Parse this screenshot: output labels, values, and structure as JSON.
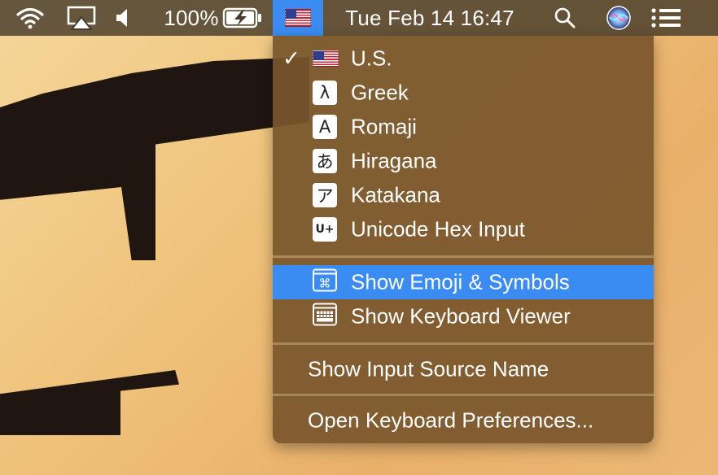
{
  "menubar": {
    "battery_percent": "100%",
    "datetime": "Tue Feb 14  16:47"
  },
  "input_menu": {
    "sources": [
      {
        "label": "U.S.",
        "icon": "us-flag-icon",
        "checked": true
      },
      {
        "label": "Greek",
        "icon": "λ"
      },
      {
        "label": "Romaji",
        "icon": "A"
      },
      {
        "label": "Hiragana",
        "icon": "あ"
      },
      {
        "label": "Katakana",
        "icon": "ア"
      },
      {
        "label": "Unicode Hex Input",
        "icon": "U+"
      }
    ],
    "check_mark": "✓",
    "show_emoji": "Show Emoji & Symbols",
    "show_keyboard_viewer": "Show Keyboard Viewer",
    "show_input_source_name": "Show Input Source Name",
    "open_keyboard_prefs": "Open Keyboard Preferences..."
  },
  "colors": {
    "highlight": "#3b8cf2",
    "menu_bg": "#78562c"
  }
}
